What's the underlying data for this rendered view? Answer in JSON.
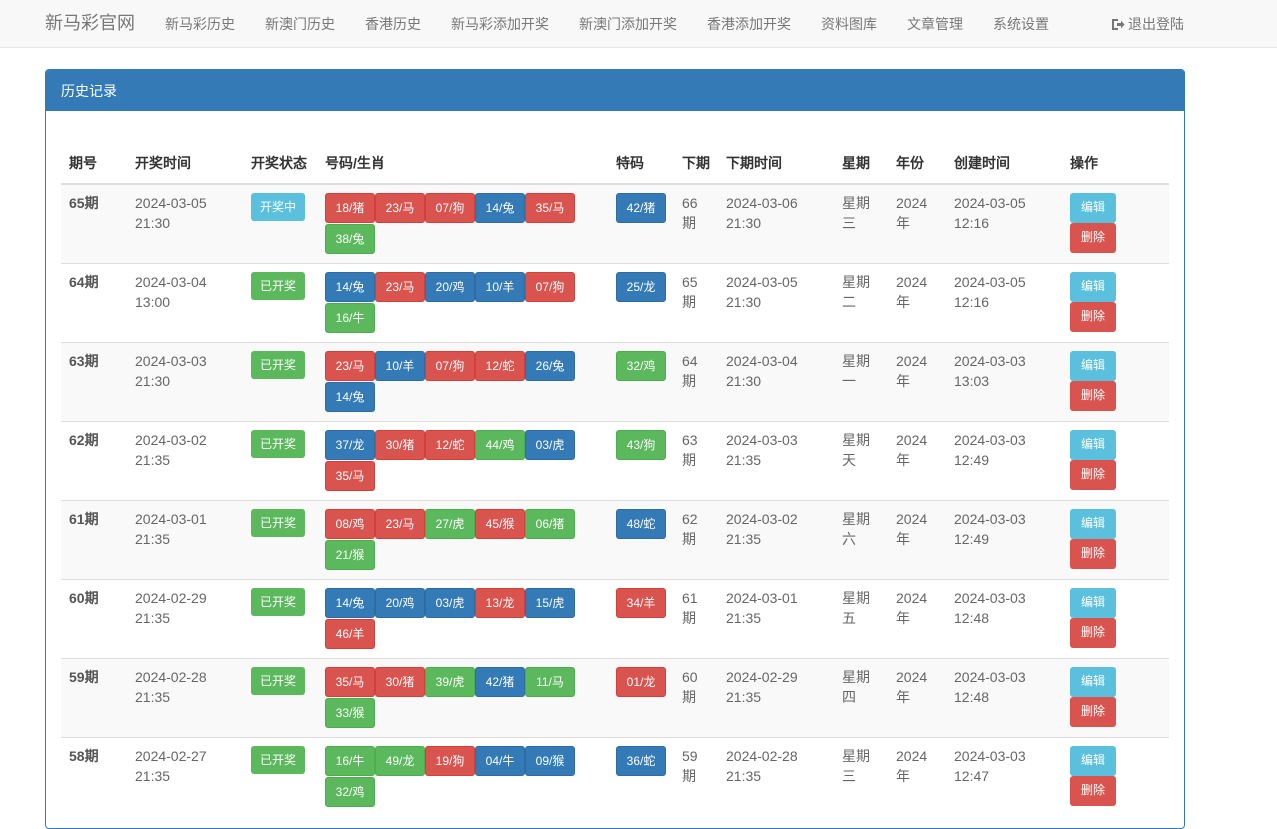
{
  "nav": {
    "brand": "新马彩官网",
    "items": [
      "新马彩历史",
      "新澳门历史",
      "香港历史",
      "新马彩添加开奖",
      "新澳门添加开奖",
      "香港添加开奖",
      "资料图库",
      "文章管理",
      "系统设置"
    ],
    "logout": "退出登陆"
  },
  "panel": {
    "title": "历史记录"
  },
  "table": {
    "headers": [
      "期号",
      "开奖时间",
      "开奖状态",
      "号码/生肖",
      "特码",
      "下期",
      "下期时间",
      "星期",
      "年份",
      "创建时间",
      "操作"
    ],
    "edit_label": "编辑",
    "delete_label": "删除",
    "rows": [
      {
        "issue": "65期",
        "time": "2024-03-05 21:30",
        "status": "开奖中",
        "status_color": "#5bc0de",
        "balls": [
          [
            "18/猪",
            "red"
          ],
          [
            "23/马",
            "red"
          ],
          [
            "07/狗",
            "red"
          ],
          [
            "14/兔",
            "blue"
          ],
          [
            "35/马",
            "red"
          ],
          [
            "38/兔",
            "green"
          ]
        ],
        "special": [
          "42/猪",
          "blue"
        ],
        "next": "66期",
        "next_time": "2024-03-06 21:30",
        "weekday": "星期三",
        "year": "2024年",
        "created": "2024-03-05 12:16"
      },
      {
        "issue": "64期",
        "time": "2024-03-04 13:00",
        "status": "已开奖",
        "status_color": "#5cb85c",
        "balls": [
          [
            "14/兔",
            "blue"
          ],
          [
            "23/马",
            "red"
          ],
          [
            "20/鸡",
            "blue"
          ],
          [
            "10/羊",
            "blue"
          ],
          [
            "07/狗",
            "red"
          ],
          [
            "16/牛",
            "green"
          ]
        ],
        "special": [
          "25/龙",
          "blue"
        ],
        "next": "65期",
        "next_time": "2024-03-05 21:30",
        "weekday": "星期二",
        "year": "2024年",
        "created": "2024-03-05 12:16"
      },
      {
        "issue": "63期",
        "time": "2024-03-03 21:30",
        "status": "已开奖",
        "status_color": "#5cb85c",
        "balls": [
          [
            "23/马",
            "red"
          ],
          [
            "10/羊",
            "blue"
          ],
          [
            "07/狗",
            "red"
          ],
          [
            "12/蛇",
            "red"
          ],
          [
            "26/兔",
            "blue"
          ],
          [
            "14/兔",
            "blue"
          ]
        ],
        "special": [
          "32/鸡",
          "green"
        ],
        "next": "64期",
        "next_time": "2024-03-04 21:30",
        "weekday": "星期一",
        "year": "2024年",
        "created": "2024-03-03 13:03"
      },
      {
        "issue": "62期",
        "time": "2024-03-02 21:35",
        "status": "已开奖",
        "status_color": "#5cb85c",
        "balls": [
          [
            "37/龙",
            "blue"
          ],
          [
            "30/猪",
            "red"
          ],
          [
            "12/蛇",
            "red"
          ],
          [
            "44/鸡",
            "green"
          ],
          [
            "03/虎",
            "blue"
          ],
          [
            "35/马",
            "red"
          ]
        ],
        "special": [
          "43/狗",
          "green"
        ],
        "next": "63期",
        "next_time": "2024-03-03 21:35",
        "weekday": "星期天",
        "year": "2024年",
        "created": "2024-03-03 12:49"
      },
      {
        "issue": "61期",
        "time": "2024-03-01 21:35",
        "status": "已开奖",
        "status_color": "#5cb85c",
        "balls": [
          [
            "08/鸡",
            "red"
          ],
          [
            "23/马",
            "red"
          ],
          [
            "27/虎",
            "green"
          ],
          [
            "45/猴",
            "red"
          ],
          [
            "06/猪",
            "green"
          ],
          [
            "21/猴",
            "green"
          ]
        ],
        "special": [
          "48/蛇",
          "blue"
        ],
        "next": "62期",
        "next_time": "2024-03-02 21:35",
        "weekday": "星期六",
        "year": "2024年",
        "created": "2024-03-03 12:49"
      },
      {
        "issue": "60期",
        "time": "2024-02-29 21:35",
        "status": "已开奖",
        "status_color": "#5cb85c",
        "balls": [
          [
            "14/兔",
            "blue"
          ],
          [
            "20/鸡",
            "blue"
          ],
          [
            "03/虎",
            "blue"
          ],
          [
            "13/龙",
            "red"
          ],
          [
            "15/虎",
            "blue"
          ],
          [
            "46/羊",
            "red"
          ]
        ],
        "special": [
          "34/羊",
          "red"
        ],
        "next": "61期",
        "next_time": "2024-03-01 21:35",
        "weekday": "星期五",
        "year": "2024年",
        "created": "2024-03-03 12:48"
      },
      {
        "issue": "59期",
        "time": "2024-02-28 21:35",
        "status": "已开奖",
        "status_color": "#5cb85c",
        "balls": [
          [
            "35/马",
            "red"
          ],
          [
            "30/猪",
            "red"
          ],
          [
            "39/虎",
            "green"
          ],
          [
            "42/猪",
            "blue"
          ],
          [
            "11/马",
            "green"
          ],
          [
            "33/猴",
            "green"
          ]
        ],
        "special": [
          "01/龙",
          "red"
        ],
        "next": "60期",
        "next_time": "2024-02-29 21:35",
        "weekday": "星期四",
        "year": "2024年",
        "created": "2024-03-03 12:48"
      },
      {
        "issue": "58期",
        "time": "2024-02-27 21:35",
        "status": "已开奖",
        "status_color": "#5cb85c",
        "balls": [
          [
            "16/牛",
            "green"
          ],
          [
            "49/龙",
            "green"
          ],
          [
            "19/狗",
            "red"
          ],
          [
            "04/牛",
            "blue"
          ],
          [
            "09/猴",
            "blue"
          ],
          [
            "32/鸡",
            "green"
          ]
        ],
        "special": [
          "36/蛇",
          "blue"
        ],
        "next": "59期",
        "next_time": "2024-02-28 21:35",
        "weekday": "星期三",
        "year": "2024年",
        "created": "2024-03-03 12:47"
      }
    ]
  }
}
